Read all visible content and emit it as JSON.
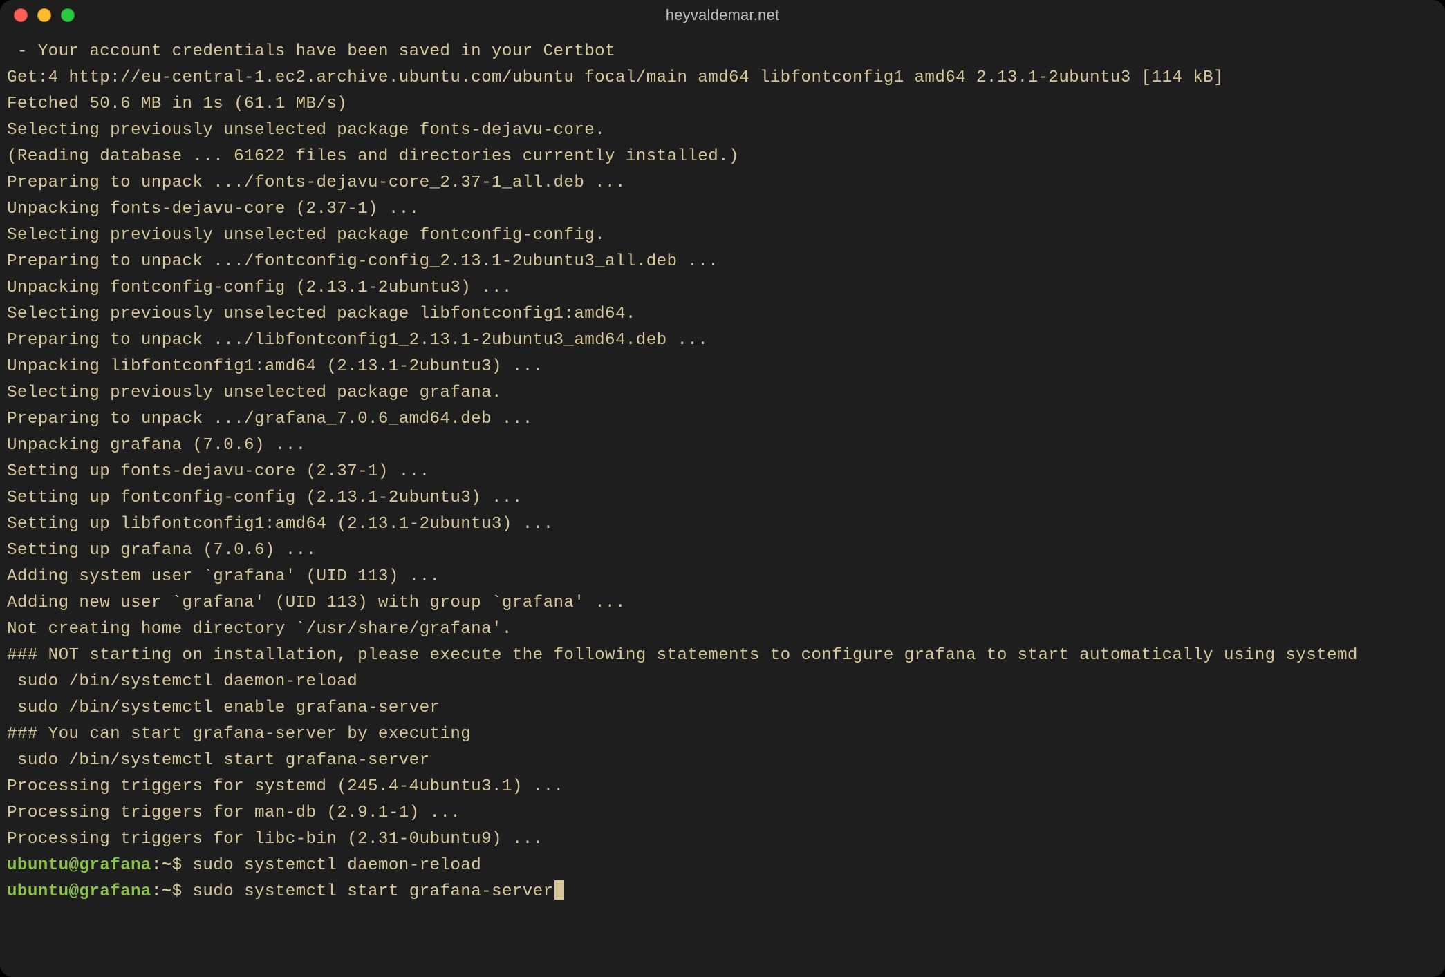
{
  "window": {
    "title": "heyvaldemar.net"
  },
  "terminal": {
    "lines": [
      " - Your account credentials have been saved in your Certbot",
      "Get:4 http://eu-central-1.ec2.archive.ubuntu.com/ubuntu focal/main amd64 libfontconfig1 amd64 2.13.1-2ubuntu3 [114 kB]",
      "Fetched 50.6 MB in 1s (61.1 MB/s)",
      "Selecting previously unselected package fonts-dejavu-core.",
      "(Reading database ... 61622 files and directories currently installed.)",
      "Preparing to unpack .../fonts-dejavu-core_2.37-1_all.deb ...",
      "Unpacking fonts-dejavu-core (2.37-1) ...",
      "Selecting previously unselected package fontconfig-config.",
      "Preparing to unpack .../fontconfig-config_2.13.1-2ubuntu3_all.deb ...",
      "Unpacking fontconfig-config (2.13.1-2ubuntu3) ...",
      "Selecting previously unselected package libfontconfig1:amd64.",
      "Preparing to unpack .../libfontconfig1_2.13.1-2ubuntu3_amd64.deb ...",
      "Unpacking libfontconfig1:amd64 (2.13.1-2ubuntu3) ...",
      "Selecting previously unselected package grafana.",
      "Preparing to unpack .../grafana_7.0.6_amd64.deb ...",
      "Unpacking grafana (7.0.6) ...",
      "Setting up fonts-dejavu-core (2.37-1) ...",
      "Setting up fontconfig-config (2.13.1-2ubuntu3) ...",
      "Setting up libfontconfig1:amd64 (2.13.1-2ubuntu3) ...",
      "Setting up grafana (7.0.6) ...",
      "Adding system user `grafana' (UID 113) ...",
      "Adding new user `grafana' (UID 113) with group `grafana' ...",
      "Not creating home directory `/usr/share/grafana'.",
      "### NOT starting on installation, please execute the following statements to configure grafana to start automatically using systemd",
      " sudo /bin/systemctl daemon-reload",
      " sudo /bin/systemctl enable grafana-server",
      "### You can start grafana-server by executing",
      " sudo /bin/systemctl start grafana-server",
      "Processing triggers for systemd (245.4-4ubuntu3.1) ...",
      "Processing triggers for man-db (2.9.1-1) ...",
      "Processing triggers for libc-bin (2.31-0ubuntu9) ..."
    ],
    "prompt1": {
      "user": "ubuntu",
      "host": "grafana",
      "path": "~",
      "cmd": "sudo systemctl daemon-reload"
    },
    "prompt2": {
      "user": "ubuntu",
      "host": "grafana",
      "path": "~",
      "cmd": "sudo systemctl start grafana-server"
    }
  }
}
